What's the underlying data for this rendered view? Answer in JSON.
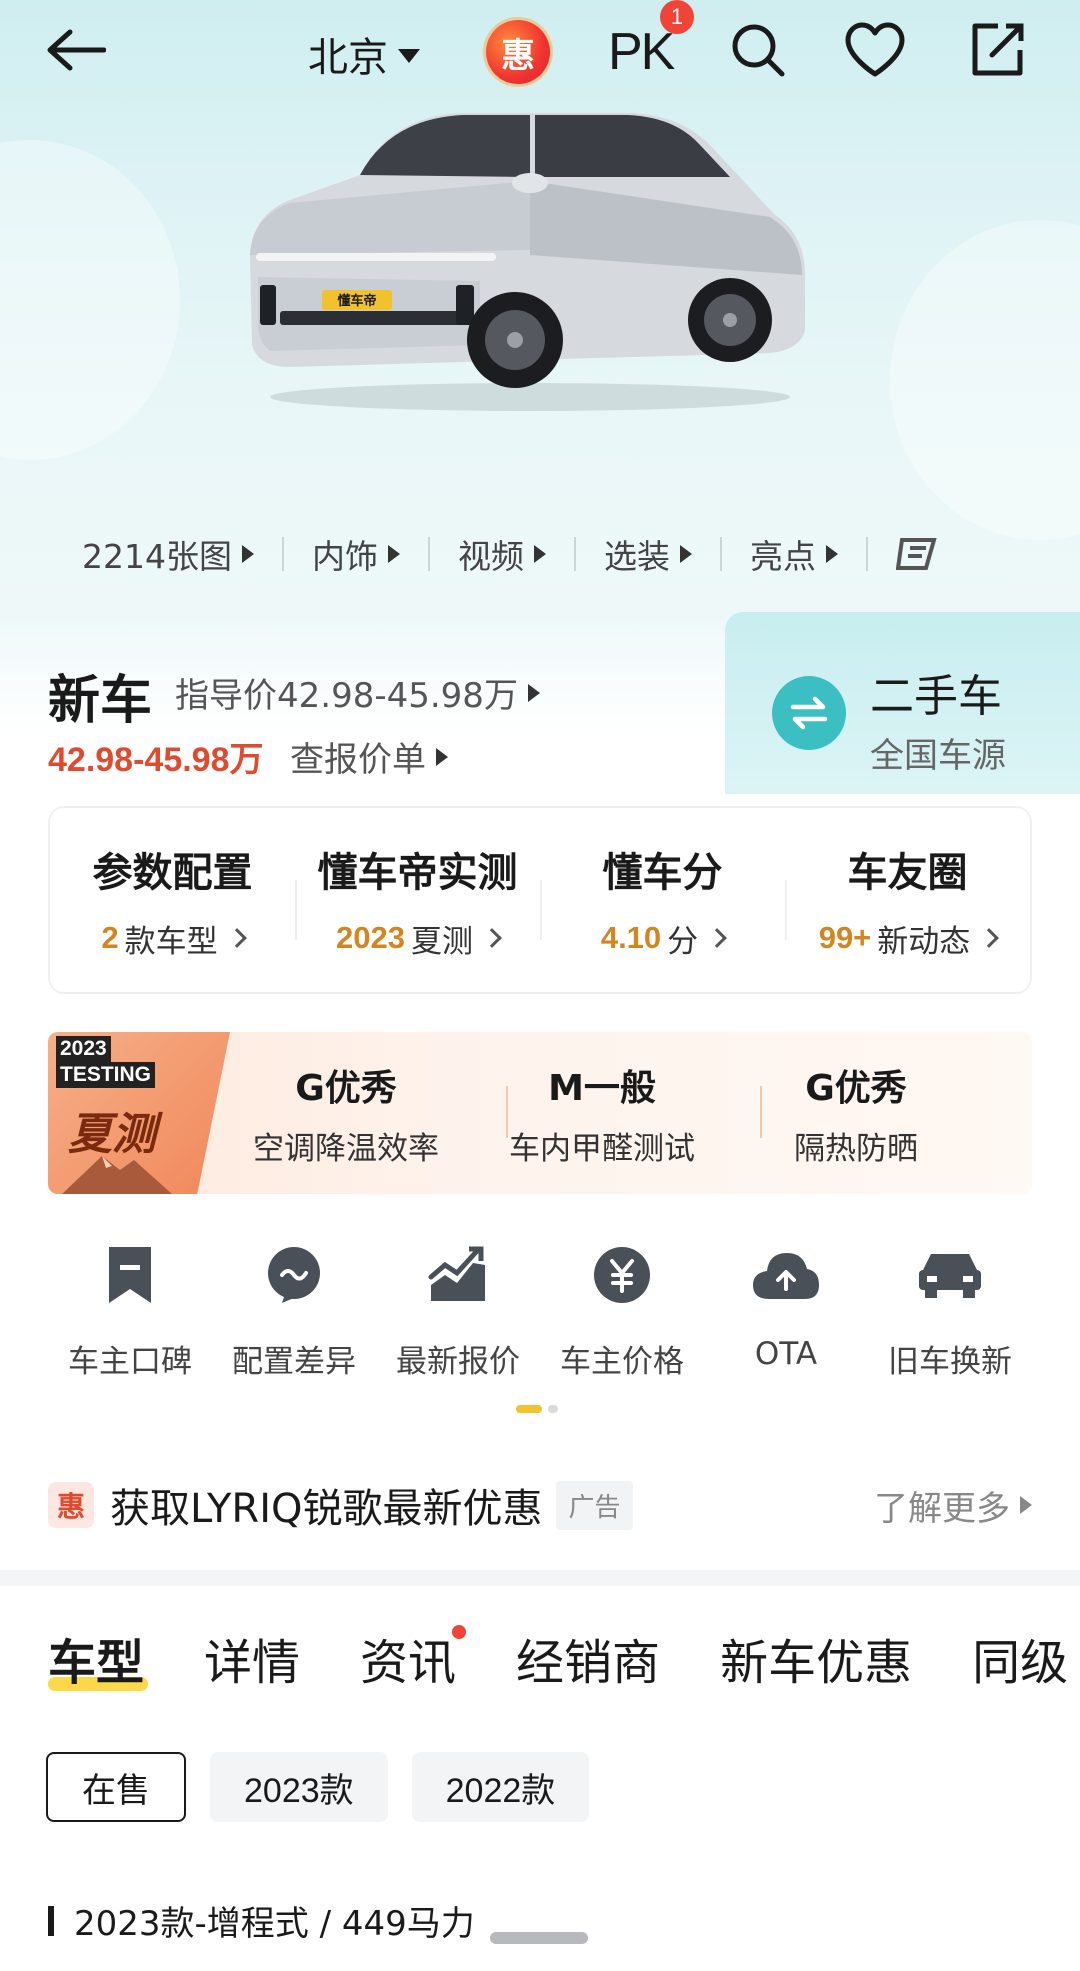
{
  "topbar": {
    "city": "北京",
    "hui_badge": "惠",
    "pk_label": "PK",
    "pk_count": "1"
  },
  "media_links": [
    {
      "label": "2214张图"
    },
    {
      "label": "内饰"
    },
    {
      "label": "视频"
    },
    {
      "label": "选装"
    },
    {
      "label": "亮点"
    }
  ],
  "car_logo": "懂车帝",
  "price": {
    "title": "新车",
    "guide": "指导价42.98-45.98万",
    "range": "42.98-45.98万",
    "check": "查报价单"
  },
  "used_car": {
    "title": "二手车",
    "sub": "全国车源"
  },
  "stats": [
    {
      "title": "参数配置",
      "hl": "2",
      "rest": "款车型"
    },
    {
      "title": "懂车帝实测",
      "hl": "2023",
      "rest": "夏测"
    },
    {
      "title": "懂车分",
      "hl": "4.10",
      "rest": "分"
    },
    {
      "title": "车友圈",
      "hl": "99+",
      "rest": "新动态"
    }
  ],
  "summer_test": {
    "year": "2023",
    "tag": "TESTING",
    "word": "夏测",
    "items": [
      {
        "grade": "G优秀",
        "desc": "空调降温效率"
      },
      {
        "grade": "M一般",
        "desc": "车内甲醛测试"
      },
      {
        "grade": "G优秀",
        "desc": "隔热防晒"
      }
    ]
  },
  "shortcuts": [
    {
      "label": "车主口碑",
      "icon": "bookmark-icon"
    },
    {
      "label": "配置差异",
      "icon": "compare-bubble-icon"
    },
    {
      "label": "最新报价",
      "icon": "trend-chart-icon"
    },
    {
      "label": "车主价格",
      "icon": "yen-icon"
    },
    {
      "label": "OTA",
      "icon": "cloud-upload-icon"
    },
    {
      "label": "旧车换新",
      "icon": "car-front-icon"
    }
  ],
  "ad": {
    "badge": "惠",
    "text": "获取LYRIQ锐歌最新优惠",
    "tag": "广告",
    "more": "了解更多"
  },
  "tabs": [
    {
      "label": "车型"
    },
    {
      "label": "详情"
    },
    {
      "label": "资讯"
    },
    {
      "label": "经销商"
    },
    {
      "label": "新车优惠"
    },
    {
      "label": "同级"
    }
  ],
  "year_filter": [
    {
      "label": "在售"
    },
    {
      "label": "2023款"
    },
    {
      "label": "2022款"
    }
  ],
  "section": {
    "title": "2023款-增程式 / 449马力"
  },
  "colors": {
    "accent_orange": "#d4851f",
    "price_red": "#e04a2f",
    "teal": "#3bbfc2",
    "tab_underline": "#ffd84a"
  }
}
